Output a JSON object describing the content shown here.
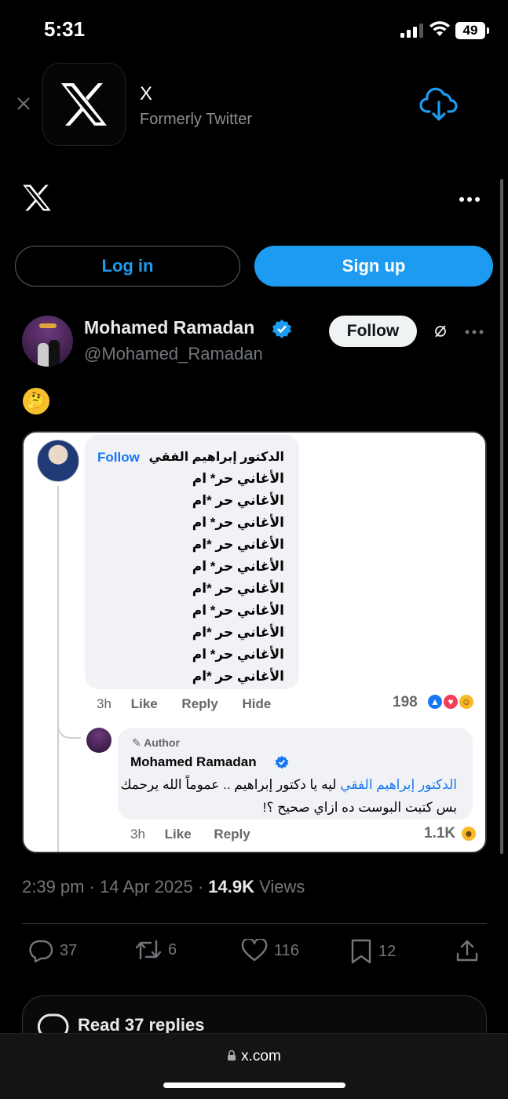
{
  "status_bar": {
    "time": "5:31",
    "battery": "49"
  },
  "app_banner": {
    "app_name": "X",
    "subtitle": "Formerly Twitter"
  },
  "auth": {
    "login_label": "Log in",
    "signup_label": "Sign up"
  },
  "tweet": {
    "author_name": "Mohamed Ramadan",
    "author_handle": "@Mohamed_Ramadan",
    "follow_label": "Follow",
    "text_emoji": "🤔",
    "timestamp": "2:39 pm · 14 Apr 2025 ·",
    "views_count": "14.9K",
    "views_label": "Views",
    "stats": {
      "replies": "37",
      "reposts": "6",
      "likes": "116",
      "bookmarks": "12"
    },
    "read_replies_label": "Read 37 replies"
  },
  "embedded_post": {
    "comment1": {
      "name": "الدكتور إبراهيم الفقي",
      "follow": "Follow",
      "dot": "·",
      "lines": [
        "الأغاني حر* ام",
        "الأغاني حر *ام",
        "الأغاني حر* ام",
        "الأغاني حر *ام",
        "الأغاني حر* ام",
        "الأغاني حر *ام",
        "الأغاني حر* ام",
        "الأغاني حر *ام",
        "الأغاني حر* ام",
        "الأغاني حر *ام"
      ],
      "time": "3h",
      "like": "Like",
      "reply": "Reply",
      "hide": "Hide",
      "reaction_count": "198"
    },
    "comment2": {
      "author_badge": "Author",
      "name": "Mohamed Ramadan",
      "mention": "الدكتور إبراهيم الفقي",
      "text": " ليه يا دكتور إبراهيم .. عموماً الله يرحمك بس كتبت البوست ده ازاي صحيح ؟!",
      "time": "3h",
      "like": "Like",
      "reply": "Reply",
      "reaction_count": "1.1K"
    }
  },
  "browser": {
    "url": "x.com"
  },
  "colors": {
    "accent": "#1d9bf0",
    "fb_blue": "#1877f2",
    "muted": "#71767b"
  }
}
